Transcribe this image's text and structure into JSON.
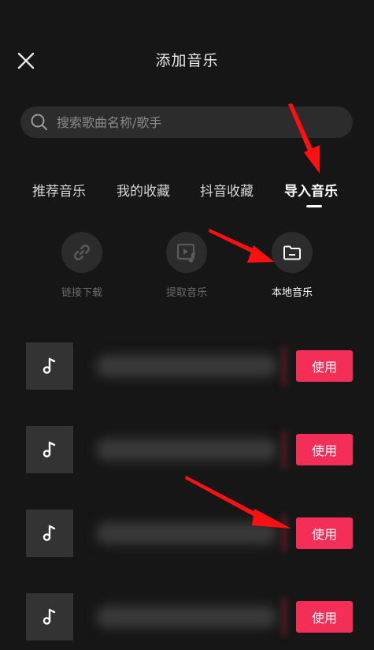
{
  "header": {
    "title": "添加音乐",
    "close_icon": "close-icon"
  },
  "search": {
    "placeholder": "搜索歌曲名称/歌手",
    "icon": "search-icon"
  },
  "tabs": [
    {
      "label": "推荐音乐"
    },
    {
      "label": "我的收藏"
    },
    {
      "label": "抖音收藏"
    },
    {
      "label": "导入音乐",
      "active": true
    }
  ],
  "import_options": [
    {
      "label": "链接下载",
      "icon": "link-icon"
    },
    {
      "label": "提取音乐",
      "icon": "video-music-icon"
    },
    {
      "label": "本地音乐",
      "icon": "folder-icon",
      "active": true
    }
  ],
  "songs": [
    {
      "use_label": "使用"
    },
    {
      "use_label": "使用"
    },
    {
      "use_label": "使用"
    },
    {
      "use_label": "使用"
    }
  ],
  "colors": {
    "background": "#161616",
    "accent": "#f52e57",
    "annotation_arrow": "#ff1010"
  }
}
